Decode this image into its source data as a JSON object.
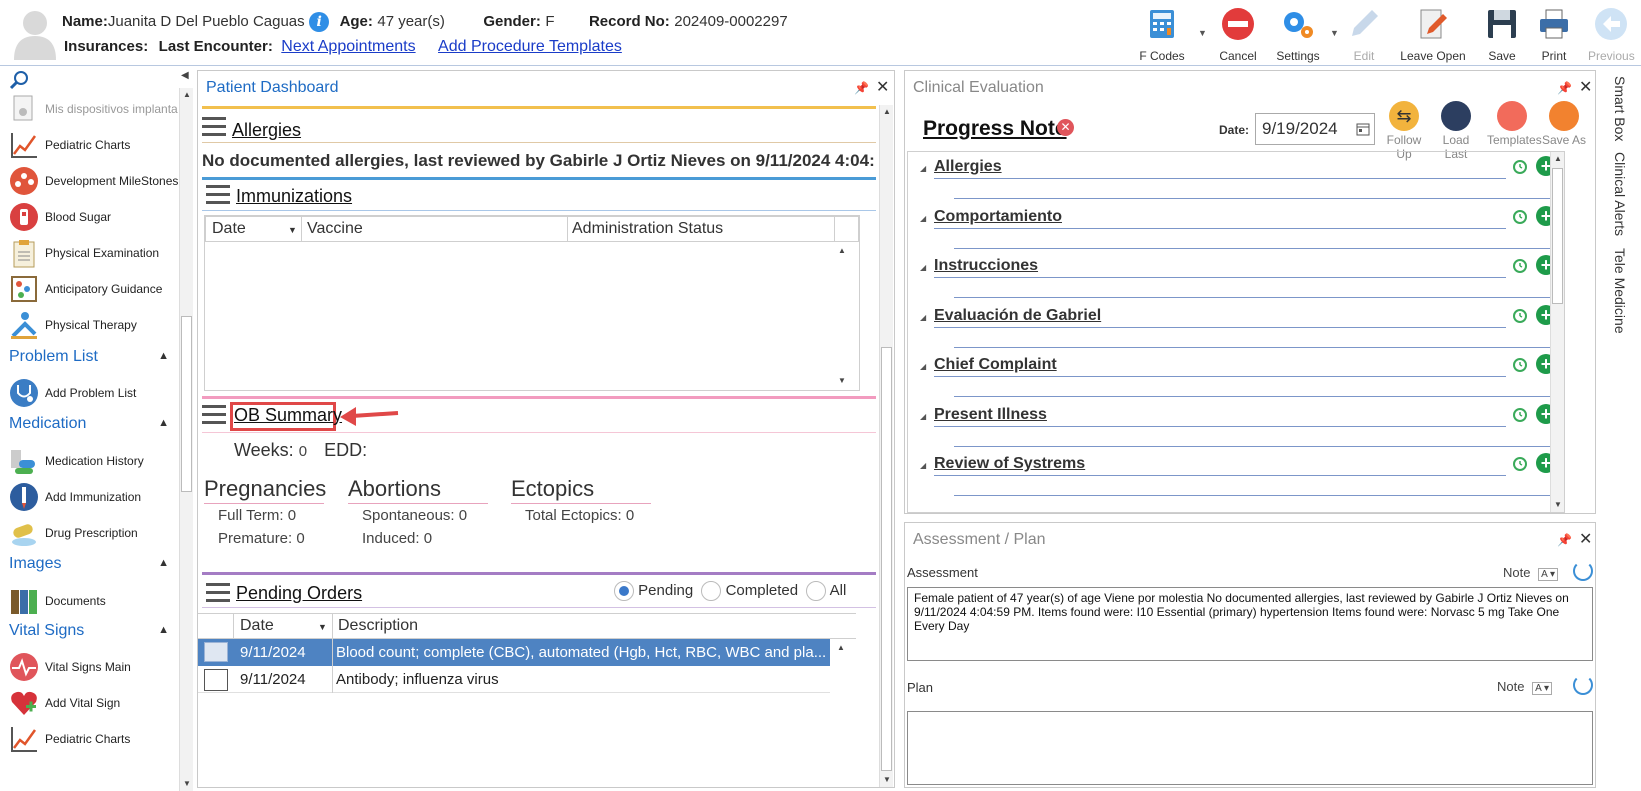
{
  "header": {
    "name_label": "Name:",
    "name_value": "Juanita D Del Pueblo Caguas",
    "age_label": "Age:",
    "age_value": "47 year(s)",
    "gender_label": "Gender:",
    "gender_value": "F",
    "record_label": "Record No:",
    "record_value": "202409-0002297",
    "insurances_label": "Insurances:",
    "last_encounter_label": "Last Encounter:",
    "next_appointments_link": "Next Appointments",
    "add_procedure_link": "Add Procedure Templates"
  },
  "toolbar": {
    "fcodes": "F Codes",
    "cancel": "Cancel",
    "settings": "Settings",
    "edit": "Edit",
    "leave_open": "Leave Open",
    "save": "Save",
    "print": "Print",
    "previous": "Previous"
  },
  "sidebar": {
    "items": [
      {
        "label": "Mis dispositivos implanta"
      },
      {
        "label": "Pediatric Charts"
      },
      {
        "label": "Development MileStones"
      },
      {
        "label": "Blood Sugar"
      },
      {
        "label": "Physical Examination"
      },
      {
        "label": "Anticipatory Guidance"
      },
      {
        "label": "Physical Therapy"
      }
    ],
    "problem_list": "Problem List",
    "add_problem_list": "Add Problem List",
    "medication": "Medication",
    "medication_history": "Medication History",
    "add_immunization": "Add Immunization",
    "drug_prescription": "Drug Prescription",
    "images": "Images",
    "documents": "Documents",
    "vital_signs": "Vital Signs",
    "vital_signs_main": "Vital Signs Main",
    "add_vital_sign": "Add Vital Sign",
    "pediatric_charts_2": "Pediatric Charts"
  },
  "dashboard": {
    "title": "Patient Dashboard",
    "allergies_title": "Allergies",
    "allergies_text": "No documented allergies, last reviewed by Gabirle J Ortiz Nieves on 9/11/2024 4:04:",
    "immunizations_title": "Immunizations",
    "imm_columns": [
      "Date",
      "Vaccine",
      "Administration Status"
    ],
    "ob_title": "OB Summary",
    "weeks_label": "Weeks:",
    "weeks_value": "0",
    "edd_label": "EDD:",
    "pregnancies": "Pregnancies",
    "full_term": "Full Term: 0",
    "premature": "Premature: 0",
    "abortions": "Abortions",
    "spontaneous": "Spontaneous: 0",
    "induced": "Induced: 0",
    "ectopics": "Ectopics",
    "total_ectopics": "Total Ectopics: 0",
    "pending_title": "Pending Orders",
    "radio_pending": "Pending",
    "radio_completed": "Completed",
    "radio_all": "All",
    "orders_columns": [
      "Date",
      "Description"
    ],
    "orders": [
      {
        "date": "9/11/2024",
        "description": "Blood count; complete (CBC), automated (Hgb, Hct, RBC, WBC and pla..."
      },
      {
        "date": "9/11/2024",
        "description": "Antibody; influenza virus"
      }
    ]
  },
  "clinical": {
    "title": "Clinical Evaluation",
    "progress_note": "Progress Note",
    "date_label": "Date:",
    "date_value": "9/19/2024",
    "follow_up": "Follow Up",
    "load_last": "Load Last",
    "templates": "Templates",
    "save_as": "Save As",
    "sections": [
      "Allergies",
      "Comportamiento",
      "Instrucciones",
      "Evaluación de Gabriel",
      "Chief Complaint",
      "Present Illness",
      "Review of Systrems"
    ]
  },
  "assessment": {
    "title": "Assessment / Plan",
    "assessment_label": "Assessment",
    "note_label": "Note",
    "assessment_text": "Female patient of 47 year(s) of age Viene por molestia     No documented allergies, last reviewed by Gabirle J Ortiz Nieves on 9/11/2024 4:04:59 PM.     Items found were:  I10 Essential (primary) hypertension  Items found were:  Norvasc 5 mg Take One Every Day",
    "plan_label": "Plan",
    "plan_note_label": "Note"
  },
  "right_tabs": [
    "Smart Box",
    "Clinical Alerts",
    "Tele Medicine"
  ]
}
